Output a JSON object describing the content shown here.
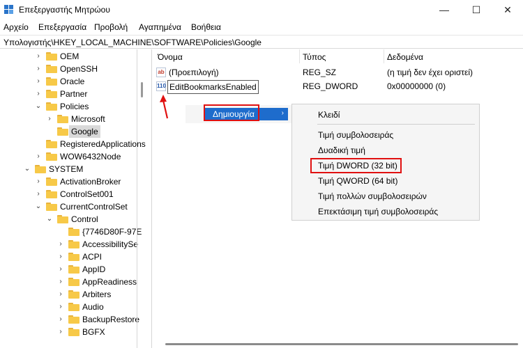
{
  "window": {
    "title": "Επεξεργαστής Μητρώου",
    "minimize_glyph": "—",
    "maximize_glyph": "☐",
    "close_glyph": "✕"
  },
  "menubar": {
    "items": [
      {
        "label": "Αρχείο"
      },
      {
        "label": "Επεξεργασία"
      },
      {
        "label": "Προβολή"
      },
      {
        "label": "Αγαπημένα"
      },
      {
        "label": "Βοήθεια"
      }
    ]
  },
  "address": "Υπολογιστής\\HKEY_LOCAL_MACHINE\\SOFTWARE\\Policies\\Google",
  "tree": {
    "items": [
      {
        "label": "OEM",
        "expand": "›"
      },
      {
        "label": "OpenSSH",
        "expand": "›"
      },
      {
        "label": "Oracle",
        "expand": "›"
      },
      {
        "label": "Partner",
        "expand": "›"
      },
      {
        "label": "Policies",
        "expand": "⌄"
      },
      {
        "label": "Microsoft",
        "expand": "›"
      },
      {
        "label": "Google",
        "expand": ""
      },
      {
        "label": "RegisteredApplications",
        "expand": ""
      },
      {
        "label": "WOW6432Node",
        "expand": "›"
      },
      {
        "label": "SYSTEM",
        "expand": "⌄"
      },
      {
        "label": "ActivationBroker",
        "expand": "›"
      },
      {
        "label": "ControlSet001",
        "expand": "›"
      },
      {
        "label": "CurrentControlSet",
        "expand": "⌄"
      },
      {
        "label": "Control",
        "expand": "⌄"
      },
      {
        "label": "{7746D80F-97E",
        "expand": ""
      },
      {
        "label": "AccessibilitySe",
        "expand": "›"
      },
      {
        "label": "ACPI",
        "expand": "›"
      },
      {
        "label": "AppID",
        "expand": "›"
      },
      {
        "label": "AppReadiness",
        "expand": "›"
      },
      {
        "label": "Arbiters",
        "expand": "›"
      },
      {
        "label": "Audio",
        "expand": "›"
      },
      {
        "label": "BackupRestore",
        "expand": "›"
      },
      {
        "label": "BGFX",
        "expand": "›"
      }
    ]
  },
  "list": {
    "headers": {
      "name": "Όνομα",
      "type": "Τύπος",
      "data": "Δεδομένα"
    },
    "rows": [
      {
        "icon": "ab",
        "name": "(Προεπιλογή)",
        "type": "REG_SZ",
        "data": "(η τιμή δεν έχει οριστεί)"
      },
      {
        "icon": "110",
        "name": "EditBookmarksEnabled",
        "type": "REG_DWORD",
        "data": "0x00000000 (0)"
      }
    ]
  },
  "context_menu": {
    "item": "Δημιουργία",
    "arrow": "›",
    "submenu": [
      "Κλειδί",
      "Τιμή συμβολοσειράς",
      "Δυαδική τιμή",
      "Τιμή DWORD (32 bit)",
      "Τιμή QWORD (64 bit)",
      "Τιμή πολλών συμβολοσειρών",
      "Επεκτάσιμη τιμή συμβολοσειράς"
    ]
  },
  "colors": {
    "highlight_box": "#e01010",
    "menu_selected": "#1e6ccc",
    "folder": "#f7c948"
  },
  "icons": [
    "registry-editor-icon",
    "folder-icon",
    "chevron-right-icon",
    "chevron-down-icon",
    "string-value-icon",
    "dword-value-icon",
    "red-arrow-icon"
  ]
}
